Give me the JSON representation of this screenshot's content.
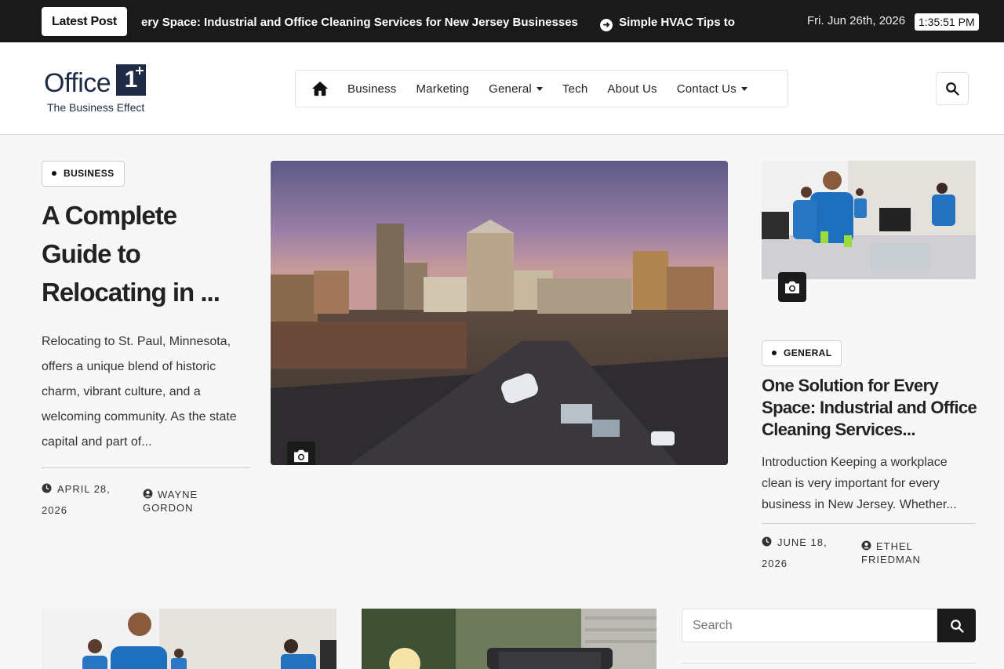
{
  "topbar": {
    "latest_label": "Latest Post",
    "ticker": [
      {
        "text": "ery Space: Industrial and Office Cleaning Services for New Jersey Businesses"
      },
      {
        "text": "Simple HVAC Tips to"
      }
    ],
    "date": "Fri. Jun 26th, 2026",
    "time": "1:35:51 PM"
  },
  "header": {
    "logo_word": "Office",
    "logo_mark": "1",
    "logo_tagline": "The Business Effect",
    "nav": [
      {
        "label": "Business",
        "has_dropdown": false
      },
      {
        "label": "Marketing",
        "has_dropdown": false
      },
      {
        "label": "General",
        "has_dropdown": true
      },
      {
        "label": "Tech",
        "has_dropdown": false
      },
      {
        "label": "About Us",
        "has_dropdown": false
      },
      {
        "label": "Contact Us",
        "has_dropdown": true
      }
    ]
  },
  "left_post": {
    "category": "BUSINESS",
    "title": "A Complete Guide to Relocating in ...",
    "excerpt": "Relocating to St. Paul, Minnesota, offers a unique blend of historic charm, vibrant culture, and a welcoming community. As the state capital and part of...",
    "date_line1": "APRIL 28,",
    "date_line2": "2026",
    "author_line1": "WAYNE",
    "author_line2": "GORDON"
  },
  "right_post": {
    "category": "GENERAL",
    "title": "One Solution for Every Space: Industrial and Office Cleaning Services...",
    "excerpt": "Introduction Keeping a workplace clean is very important for every business in New Jersey. Whether...",
    "date_line1": "JUNE 18,",
    "date_line2": "2026",
    "author_line1": "ETHEL",
    "author_line2": "FRIEDMAN"
  },
  "sidebar": {
    "search_placeholder": "Search"
  },
  "colors": {
    "dark": "#1a1a1a",
    "brand": "#1f2a44",
    "background": "#f7f7f7"
  }
}
